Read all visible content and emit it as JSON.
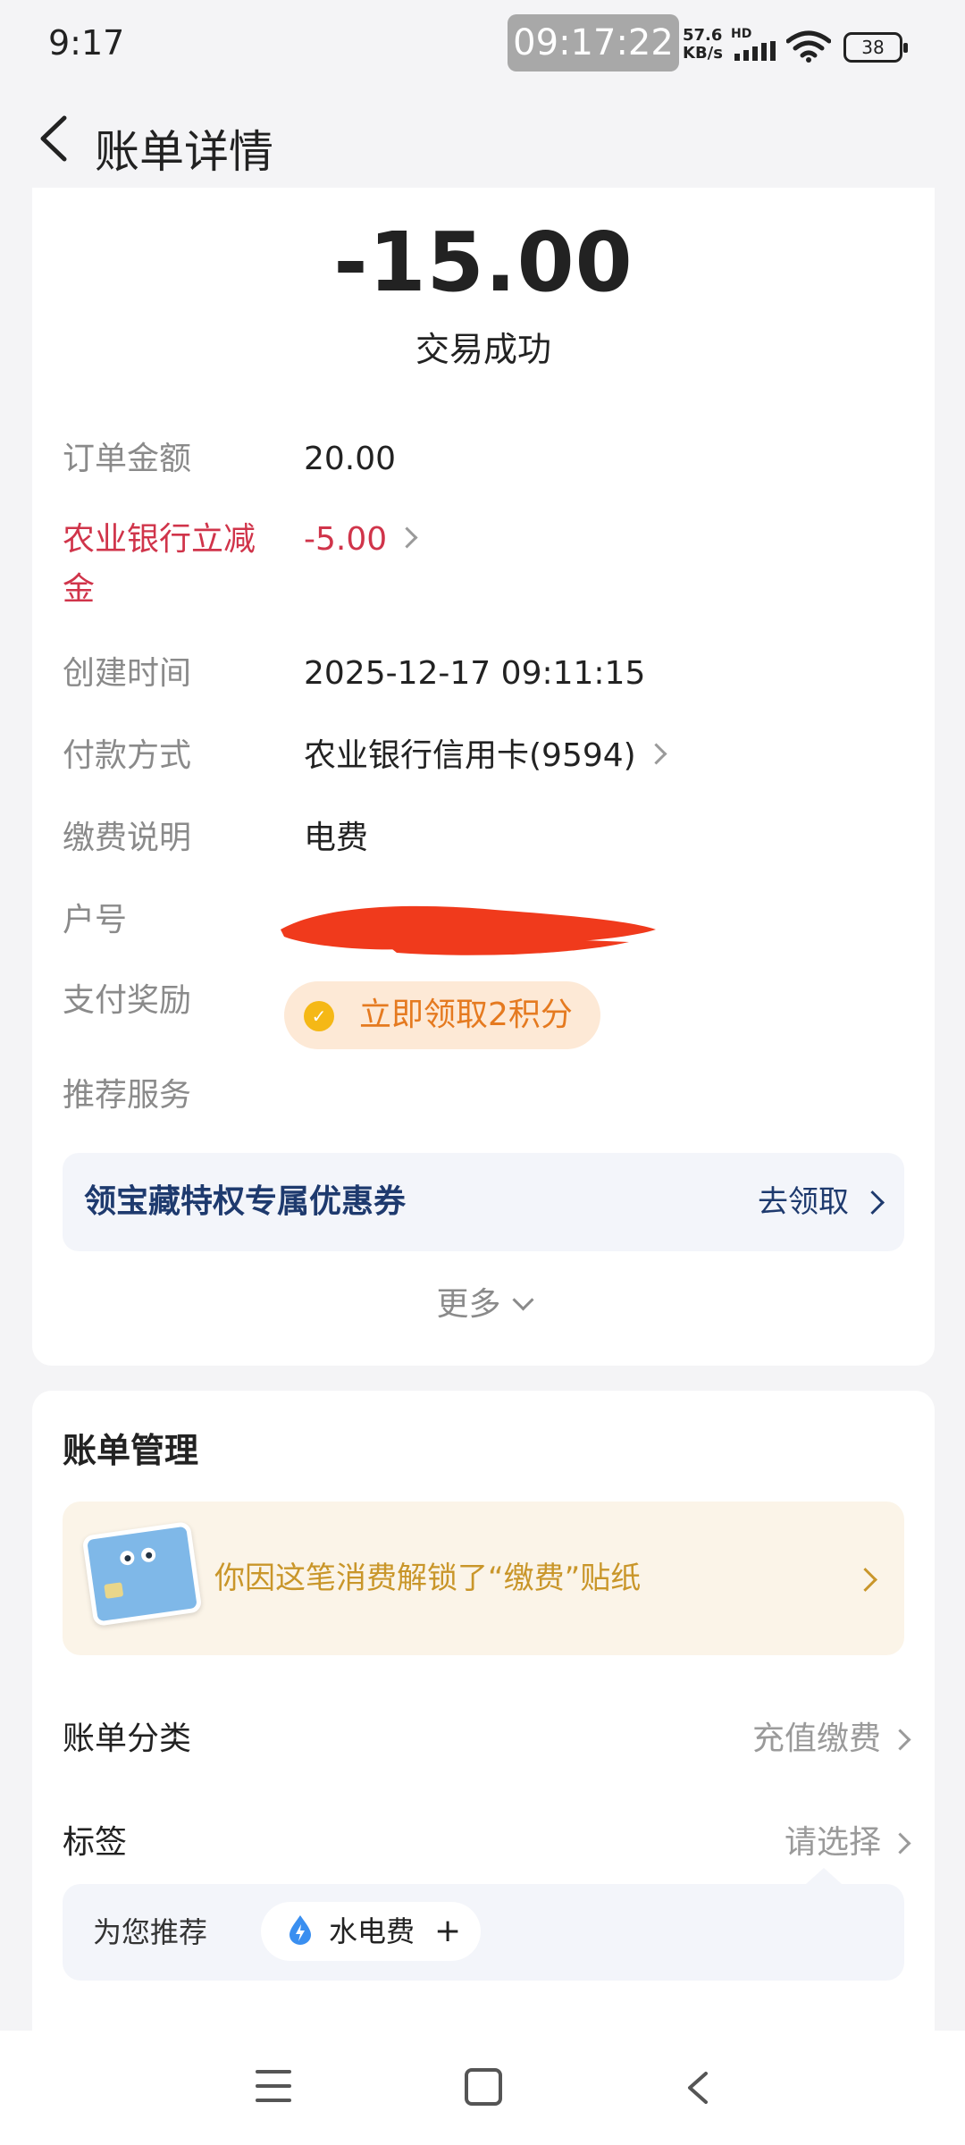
{
  "status_bar": {
    "time": "9:17",
    "clock": "09:17:22",
    "net_speed_value": "57.6",
    "net_speed_unit": "KB/s",
    "hd": "HD",
    "battery": "38"
  },
  "header": {
    "title": "账单详情"
  },
  "transaction": {
    "amount": "-15.00",
    "status": "交易成功"
  },
  "details": {
    "order_amount_label": "订单金额",
    "order_amount_value": "20.00",
    "discount_label_line1": "农业银行立减",
    "discount_label_line2": "金",
    "discount_value": "-5.00",
    "created_label": "创建时间",
    "created_value": "2025-12-17 09:11:15",
    "payment_label": "付款方式",
    "payment_value": "农业银行信用卡(9594)",
    "fee_desc_label": "缴费说明",
    "fee_desc_value": "电费",
    "account_label": "户号",
    "reward_label": "支付奖励",
    "reward_value": "立即领取2积分",
    "recommend_label": "推荐服务"
  },
  "coupon": {
    "title": "领宝藏特权专属优惠券",
    "action": "去领取"
  },
  "more": {
    "label": "更多"
  },
  "bill_management": {
    "title": "账单管理",
    "sticker_text": "你因这笔消费解锁了“缴费”贴纸",
    "category_label": "账单分类",
    "category_value": "充值缴费",
    "tag_label": "标签",
    "tag_value": "请选择",
    "recommend_label": "为您推荐",
    "recommend_chip": "水电费",
    "recommend_plus": "+"
  },
  "colors": {
    "accent_red": "#d0344a",
    "reward_orange": "#e57a20",
    "coupon_blue": "#1e3a6e",
    "sticker_gold": "#c9962a",
    "redaction": "#f03a1c"
  }
}
